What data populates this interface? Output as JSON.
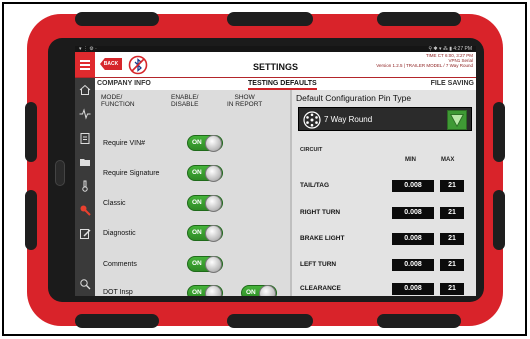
{
  "statusbar": {
    "left": "▾ ⋮ ⚙ ·",
    "right": "⚲ ✱ ▾ ⁂ ▮ 4:27 PM"
  },
  "header": {
    "back_label": "BACK",
    "title": "SETTINGS",
    "version_lines": [
      "TIME CT 6:00, 3:27 PM",
      "VPN1 Serial",
      "Version 1.2.5 | TRAILER MODEL / 7 Way Round"
    ]
  },
  "tabs": [
    {
      "label": "COMPANY INFO",
      "active": false
    },
    {
      "label": "TESTING DEFAULTS",
      "active": true
    },
    {
      "label": "FILE SAVING",
      "active": false
    }
  ],
  "settings": {
    "headers": [
      "MODE/\nFUNCTION",
      "ENABLE/\nDISABLE",
      "SHOW\nIN REPORT"
    ],
    "rows": [
      {
        "label": "Require VIN#",
        "enable": "ON",
        "report": null
      },
      {
        "label": "Require Signature",
        "enable": "ON",
        "report": null
      },
      {
        "label": "Classic",
        "enable": "ON",
        "report": null
      },
      {
        "label": "Diagnostic",
        "enable": "ON",
        "report": null
      },
      {
        "label": "Comments",
        "enable": "ON",
        "report": null
      },
      {
        "label": "DOT Insp",
        "enable": "ON",
        "report": "ON"
      }
    ]
  },
  "config": {
    "title": "Default Configuration Pin Type",
    "selected": "7 Way Round",
    "circuit_label": "CIRCUIT",
    "min_label": "MIN",
    "max_label": "MAX",
    "circuits": [
      {
        "name": "TAIL/TAG",
        "min": "0.008",
        "max": "21"
      },
      {
        "name": "RIGHT TURN",
        "min": "0.008",
        "max": "21"
      },
      {
        "name": "BRAKE LIGHT",
        "min": "0.008",
        "max": "21"
      },
      {
        "name": "LEFT TURN",
        "min": "0.008",
        "max": "21"
      },
      {
        "name": "CLEARANCE",
        "min": "0.008",
        "max": "21"
      }
    ]
  },
  "colors": {
    "accent": "#d6262b",
    "toggle_on": "#3a9e30",
    "case": "#d9232a",
    "dropdown_arrow": "#3f9a35"
  },
  "nav_icons": [
    "home-icon",
    "pulse-icon",
    "clipboard-icon",
    "folder-icon",
    "thermometer-icon",
    "wrench-icon",
    "edit-icon",
    "scan-icon"
  ]
}
